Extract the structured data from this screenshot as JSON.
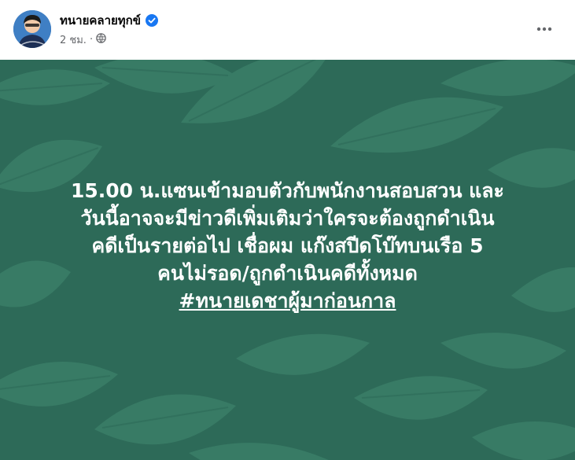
{
  "author": {
    "name": "ทนายคลายทุกข์",
    "verified": true,
    "time": "2 ชม.",
    "dot": "·",
    "audience_icon": "globe-icon"
  },
  "post": {
    "lines": [
      "15.00 น.แซนเข้ามอบตัวกับพนักงานสอบสวน และ",
      "วันนี้อาจจะมีข่าวดีเพิ่มเติมว่าใครจะต้องถูกดำเนิน",
      "คดีเป็นรายต่อไป เชื่อผม แก๊งสปีดโบ๊ทบนเรือ 5",
      "คนไม่รอด/ถูกดำเนินคดีทั้งหมด"
    ],
    "hashtag": "#ทนายเดชาผู้มาก่อนกาล"
  },
  "colors": {
    "background": "#2d6a58",
    "leaf": "#3a7d67",
    "verified_blue": "#1877f2"
  }
}
